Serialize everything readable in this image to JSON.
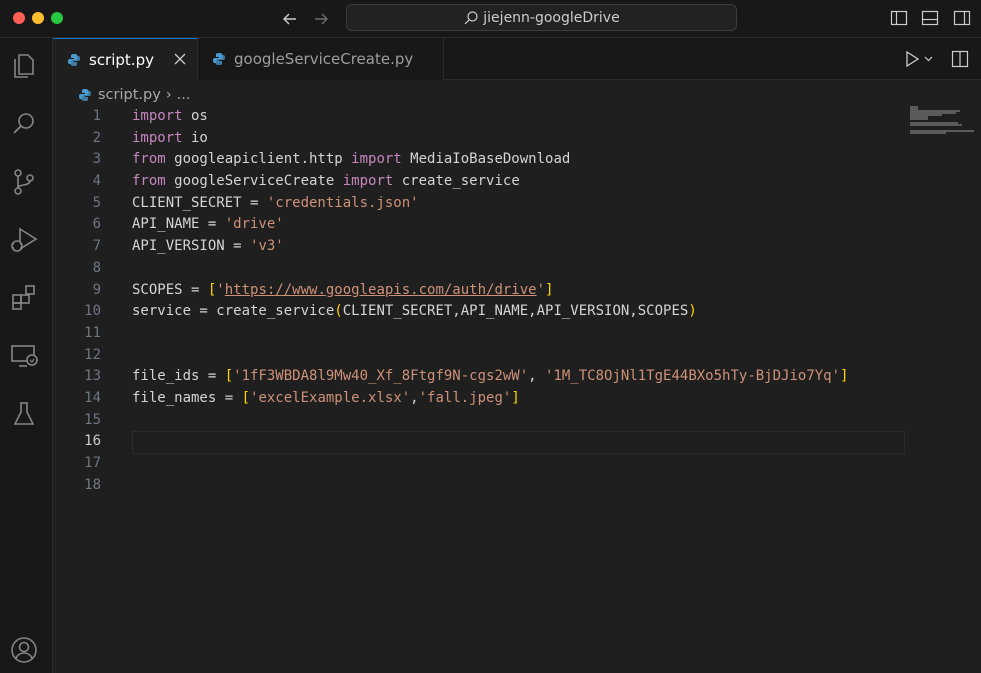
{
  "titlebar": {
    "search_text": "jiejenn-googleDrive"
  },
  "tabs": [
    {
      "label": "script.py",
      "active": true
    },
    {
      "label": "googleServiceCreate.py",
      "active": false
    }
  ],
  "breadcrumb": {
    "file": "script.py",
    "symbol": "..."
  },
  "line_numbers": [
    "1",
    "2",
    "3",
    "4",
    "5",
    "6",
    "7",
    "8",
    "9",
    "10",
    "11",
    "12",
    "13",
    "14",
    "15",
    "16",
    "17",
    "18"
  ],
  "code": {
    "l1_kw": "import",
    "l1_rest": " os",
    "l2_kw": "import",
    "l2_rest": " io",
    "l3_kw1": "from",
    "l3_mod": " googleapiclient.http ",
    "l3_kw2": "import",
    "l3_rest": " MediaIoBaseDownload",
    "l4_kw1": "from",
    "l4_mod": " googleServiceCreate ",
    "l4_kw2": "import",
    "l4_rest": " create_service",
    "l5_var": "CLIENT_SECRET = ",
    "l5_str": "'credentials.json'",
    "l6_var": "API_NAME = ",
    "l6_str": "'drive'",
    "l7_var": "API_VERSION = ",
    "l7_str": "'v3'",
    "l9_var": "SCOPES = ",
    "l9_open": "[",
    "l9_q1": "'",
    "l9_url": "https://www.googleapis.com/auth/drive",
    "l9_q2": "'",
    "l9_close": "]",
    "l10_var": "service = create_service",
    "l10_open": "(",
    "l10_args": "CLIENT_SECRET,API_NAME,API_VERSION,SCOPES",
    "l10_close": ")",
    "l13_var": "file_ids = ",
    "l13_open": "[",
    "l13_s1": "'1fF3WBDA8l9Mw40_Xf_8Ftgf9N-cgs2wW'",
    "l13_sep": ", ",
    "l13_s2": "'1M_TC8OjNl1TgE44BXo5hTy-BjDJio7Yq'",
    "l13_close": "]",
    "l14_var": "file_names = ",
    "l14_open": "[",
    "l14_s1": "'excelExample.xlsx'",
    "l14_sep": ",",
    "l14_s2": "'fall.jpeg'",
    "l14_close": "]"
  },
  "editor": {
    "current_line": "16"
  },
  "colors": {
    "accent": "#0078d4",
    "keyword": "#c586c0",
    "string": "#ce9178",
    "bracket": "#ffd700"
  }
}
